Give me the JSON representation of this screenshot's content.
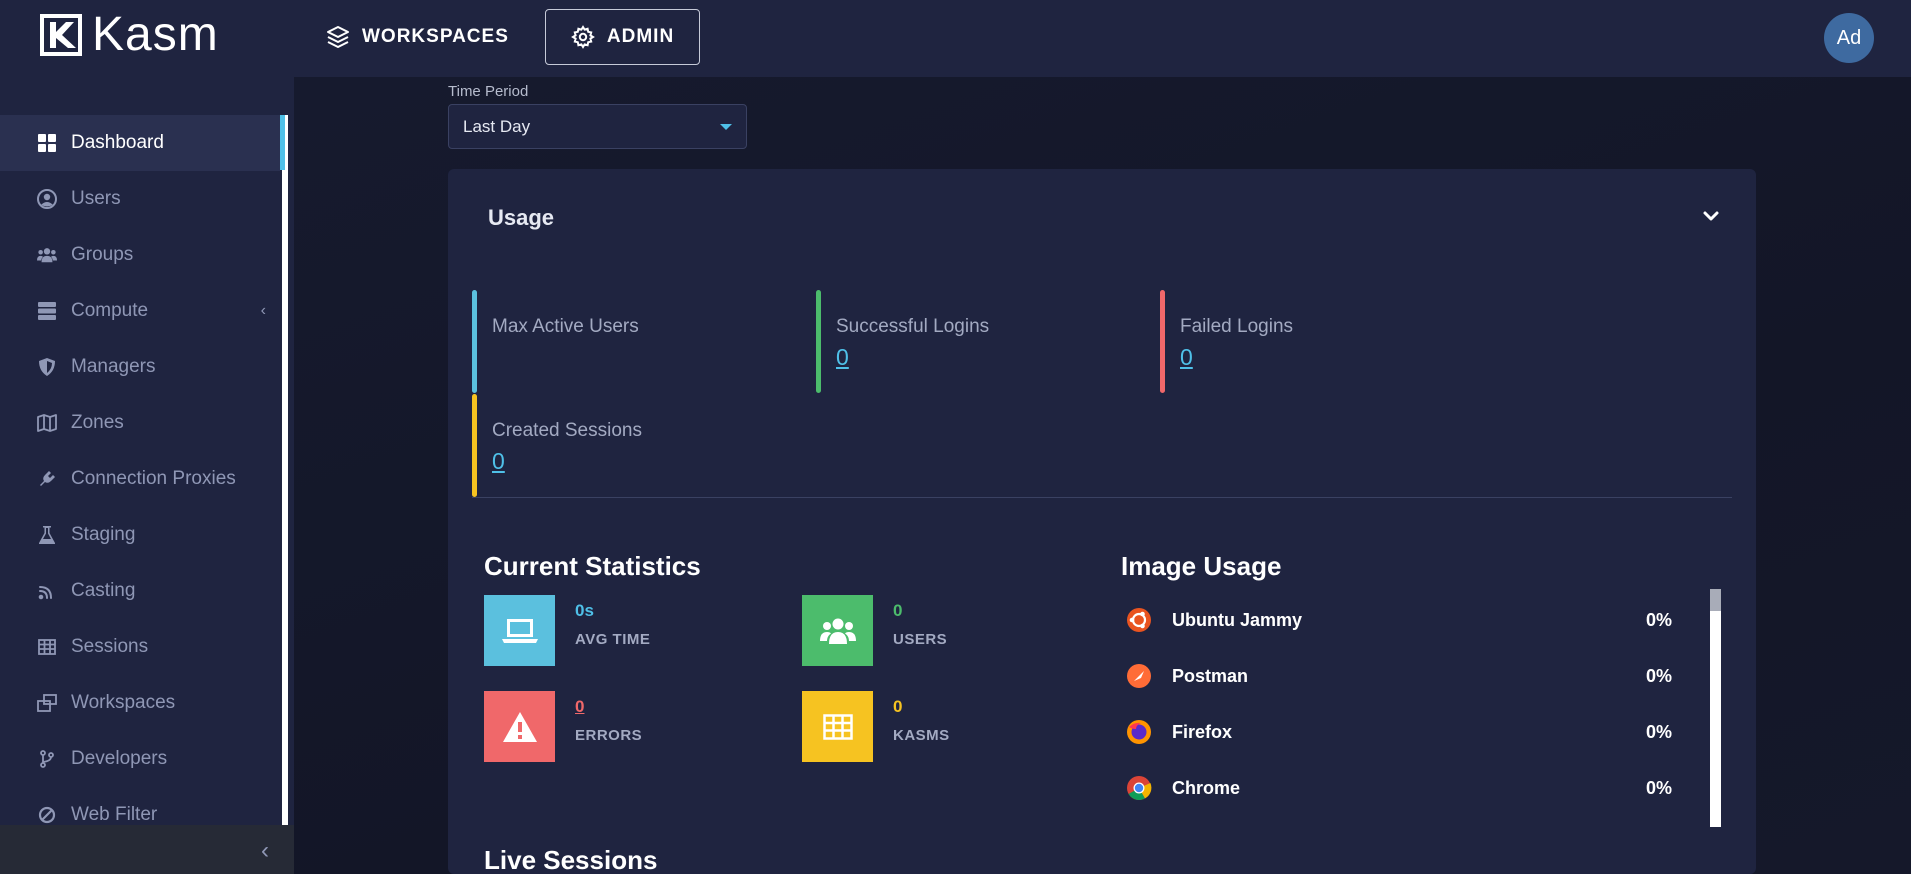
{
  "app": {
    "brand": "Kasm",
    "avatar_initials": "Ad"
  },
  "topnav": [
    {
      "label": "WORKSPACES",
      "icon": "layers-icon",
      "active": false
    },
    {
      "label": "ADMIN",
      "icon": "gear-icon",
      "active": true
    }
  ],
  "sidebar": {
    "items": [
      {
        "label": "Dashboard",
        "icon": "dashboard-icon",
        "active": true
      },
      {
        "label": "Users",
        "icon": "user-circle-icon"
      },
      {
        "label": "Groups",
        "icon": "users-group-icon"
      },
      {
        "label": "Compute",
        "icon": "server-icon",
        "has_submenu": true
      },
      {
        "label": "Managers",
        "icon": "shield-icon"
      },
      {
        "label": "Zones",
        "icon": "map-icon"
      },
      {
        "label": "Connection Proxies",
        "icon": "plug-icon"
      },
      {
        "label": "Staging",
        "icon": "flask-icon"
      },
      {
        "label": "Casting",
        "icon": "cast-icon"
      },
      {
        "label": "Sessions",
        "icon": "table-icon"
      },
      {
        "label": "Workspaces",
        "icon": "windows-icon"
      },
      {
        "label": "Developers",
        "icon": "branch-icon"
      },
      {
        "label": "Web Filter",
        "icon": "ban-icon"
      }
    ],
    "submenu_caret": "‹",
    "collapse_glyph": "‹"
  },
  "filters": {
    "time_period_label": "Time Period",
    "time_period_value": "Last Day"
  },
  "usage": {
    "title": "Usage",
    "metrics": [
      {
        "label": "Max Active Users",
        "value": "",
        "color": "#5bc0de"
      },
      {
        "label": "Successful Logins",
        "value": "0",
        "color": "#4cbc6c"
      },
      {
        "label": "Failed Logins",
        "value": "0",
        "color": "#f0686a"
      },
      {
        "label": "Created Sessions",
        "value": "0",
        "color": "#f6c321"
      }
    ]
  },
  "current_statistics": {
    "title": "Current Statistics",
    "stats": [
      {
        "value": "0s",
        "caption": "AVG TIME",
        "icon": "laptop-icon",
        "color": "#5bc0de",
        "value_color": "#4fc0e8"
      },
      {
        "value": "0",
        "caption": "USERS",
        "icon": "users-icon",
        "color": "#4cbc6c",
        "value_color": "#4cbc6c"
      },
      {
        "value": "0",
        "caption": "ERRORS",
        "icon": "warning-icon",
        "color": "#f0686a",
        "value_color": "#f0686a"
      },
      {
        "value": "0",
        "caption": "KASMS",
        "icon": "grid-icon",
        "color": "#f6c321",
        "value_color": "#f6c321"
      }
    ]
  },
  "image_usage": {
    "title": "Image Usage",
    "images": [
      {
        "name": "Ubuntu Jammy",
        "percent": "0%",
        "icon": "ubuntu-icon"
      },
      {
        "name": "Postman",
        "percent": "0%",
        "icon": "postman-icon"
      },
      {
        "name": "Firefox",
        "percent": "0%",
        "icon": "firefox-icon"
      },
      {
        "name": "Chrome",
        "percent": "0%",
        "icon": "chrome-icon"
      }
    ]
  },
  "live_sessions": {
    "title": "Live Sessions"
  }
}
